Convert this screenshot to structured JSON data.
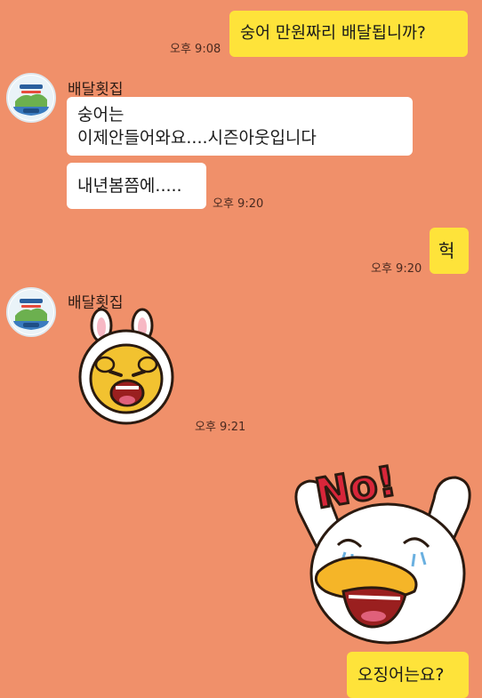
{
  "messages": {
    "m1": {
      "text": "숭어 만원짜리 배달됩니까?",
      "time": "오후 9:08"
    },
    "sender1": "배달횟집",
    "m2": {
      "line1": "숭어는",
      "line2": "이제안들어와요....시즌아웃입니다"
    },
    "m3": {
      "text": "내년봄쯤에.....",
      "time": "오후 9:20"
    },
    "m4": {
      "text": "헉",
      "time": "오후 9:20"
    },
    "sender2": "배달횟집",
    "m5": {
      "time": "오후 9:21",
      "sticker": "crying-lion-sticker"
    },
    "m6": {
      "sticker_text": "No!",
      "sticker": "no-duck-sticker"
    },
    "m7": {
      "text": "오징어는요?"
    }
  },
  "colors": {
    "background": "#f0906a",
    "my_bubble": "#fee33a",
    "their_bubble": "#ffffff"
  }
}
